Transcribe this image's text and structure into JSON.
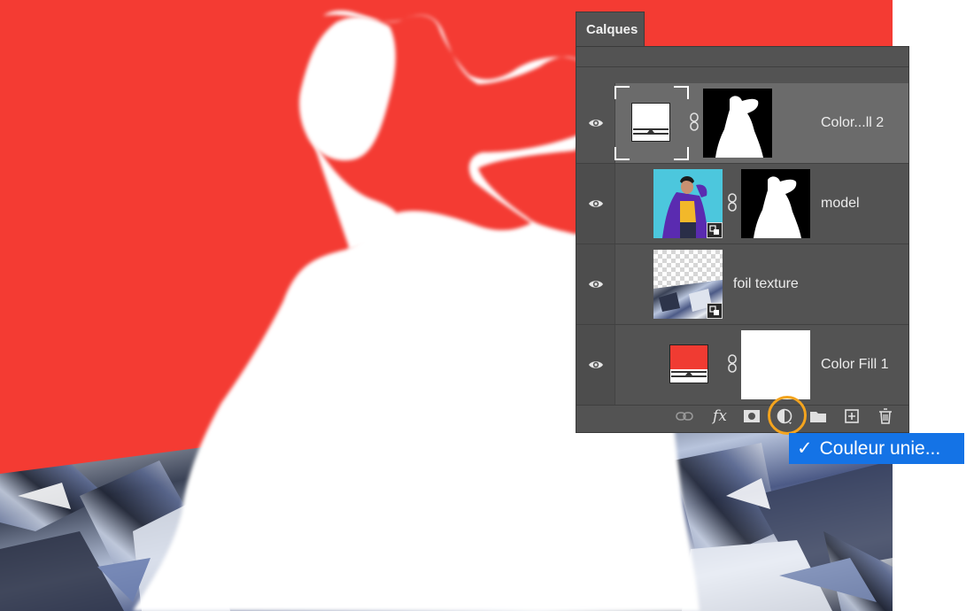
{
  "panel": {
    "title": "Calques",
    "layers": [
      {
        "name": "Color...ll 2",
        "visible": true,
        "selected": true,
        "type": "fill-layer",
        "fill_color": "#ffffff",
        "has_mask": true,
        "mask": "silhouette"
      },
      {
        "name": "model",
        "visible": true,
        "selected": false,
        "type": "smart-object",
        "has_mask": true,
        "mask": "silhouette"
      },
      {
        "name": "foil texture",
        "visible": true,
        "selected": false,
        "type": "smart-object",
        "has_mask": false
      },
      {
        "name": "Color Fill 1",
        "visible": true,
        "selected": false,
        "type": "fill-layer",
        "fill_color": "#f03b32",
        "has_mask": true,
        "mask": "white"
      }
    ],
    "toolbar": [
      "link-icon",
      "fx-icon",
      "mask-icon",
      "adjustment-layer-icon",
      "folder-icon",
      "new-layer-icon",
      "trash-icon"
    ],
    "fx_label": "fx"
  },
  "menu": {
    "item_label": "Couleur unie...",
    "checkmark": "✓",
    "highlight_color": "#1473e6"
  },
  "colors": {
    "accent_ring": "#f4a41e",
    "canvas_red": "#f43b33",
    "panel_bg": "#535353"
  }
}
